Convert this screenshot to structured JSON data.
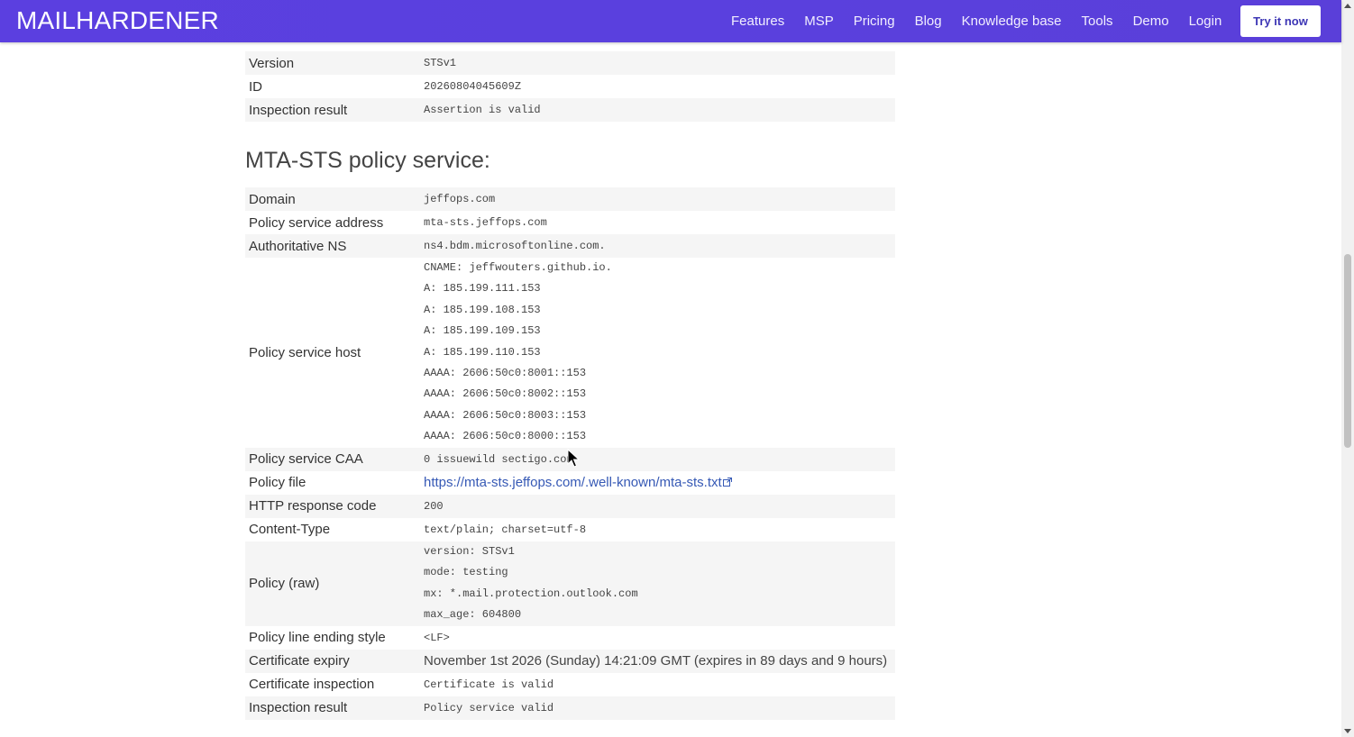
{
  "nav": {
    "brand": "MAILHARDENER",
    "links": [
      "Features",
      "MSP",
      "Pricing",
      "Blog",
      "Knowledge base",
      "Tools",
      "Demo",
      "Login"
    ],
    "cta": "Try it now"
  },
  "assertion": {
    "rows": [
      {
        "label": "Version",
        "value": "STSv1"
      },
      {
        "label": "ID",
        "value": "20260804045609Z"
      },
      {
        "label": "Inspection result",
        "value": "Assertion is valid"
      }
    ]
  },
  "section_title": "MTA-STS policy service:",
  "policy": {
    "domain_label": "Domain",
    "domain": "jeffops.com",
    "address_label": "Policy service address",
    "address": "mta-sts.jeffops.com",
    "ns_label": "Authoritative NS",
    "ns": "ns4.bdm.microsoftonline.com.",
    "host_label": "Policy service host",
    "host_records": [
      "CNAME: jeffwouters.github.io.",
      "A: 185.199.111.153",
      "A: 185.199.108.153",
      "A: 185.199.109.153",
      "A: 185.199.110.153",
      "AAAA: 2606:50c0:8001::153",
      "AAAA: 2606:50c0:8002::153",
      "AAAA: 2606:50c0:8003::153",
      "AAAA: 2606:50c0:8000::153"
    ],
    "caa_label": "Policy service CAA",
    "caa": "0 issuewild sectigo.com",
    "file_label": "Policy file",
    "file_url": "https://mta-sts.jeffops.com/.well-known/mta-sts.txt",
    "http_label": "HTTP response code",
    "http": "200",
    "ctype_label": "Content-Type",
    "ctype": "text/plain; charset=utf-8",
    "raw_label": "Policy (raw)",
    "raw_lines": [
      "version: STSv1",
      "mode: testing",
      "mx: *.mail.protection.outlook.com",
      "max_age: 604800"
    ],
    "ending_label": "Policy line ending style",
    "ending": "<LF>",
    "expiry_label": "Certificate expiry",
    "expiry": "November 1st 2026 (Sunday) 14:21:09 GMT (expires in 89 days and 9 hours)",
    "cert_label": "Certificate inspection",
    "cert": "Certificate is valid",
    "result_label": "Inspection result",
    "result": "Policy service valid"
  },
  "colors": {
    "nav": "#5a40de",
    "ok": "#3aae3a",
    "link": "#3659b5"
  },
  "icons": [
    "external-link-icon",
    "mouse-cursor-icon"
  ]
}
